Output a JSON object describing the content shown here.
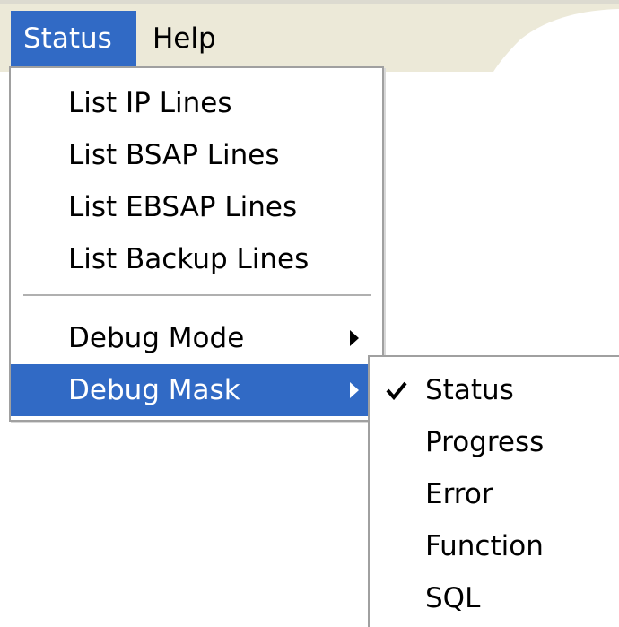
{
  "menubar": {
    "items": [
      {
        "label": "Status",
        "active": true
      },
      {
        "label": "Help",
        "active": false
      }
    ]
  },
  "status_menu": {
    "items": [
      {
        "label": "List IP Lines"
      },
      {
        "label": "List BSAP Lines"
      },
      {
        "label": "List EBSAP Lines"
      },
      {
        "label": "List Backup Lines"
      },
      {
        "label": "Debug Mode",
        "has_submenu": true
      },
      {
        "label": "Debug Mask",
        "has_submenu": true,
        "highlighted": true
      }
    ]
  },
  "debug_mask_submenu": {
    "items": [
      {
        "label": "Status",
        "checked": true
      },
      {
        "label": "Progress",
        "checked": false
      },
      {
        "label": "Error",
        "checked": false
      },
      {
        "label": "Function",
        "checked": false
      },
      {
        "label": "SQL",
        "checked": false
      }
    ]
  },
  "colors": {
    "highlight": "#316ac5",
    "menubar_tan": "#ece9d8",
    "border": "#a0a0a0"
  }
}
